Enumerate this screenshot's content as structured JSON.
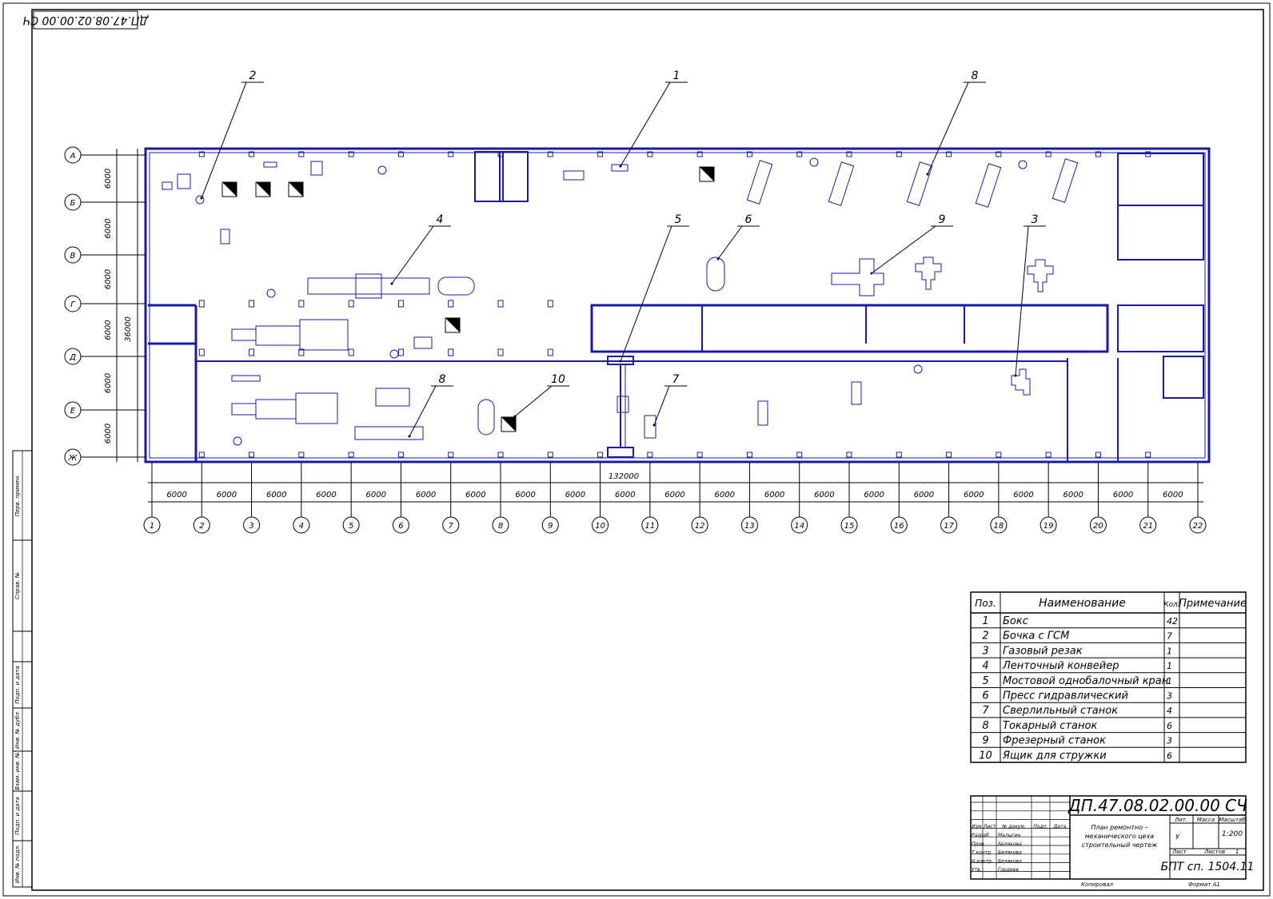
{
  "drawing": {
    "code_top": "ДП.47.08.02.00.00 СЧ",
    "code": "ДП.47.08.02.00.00 СЧ",
    "title_lines": [
      "План ремонтно –",
      "механического цеха",
      "строительный чертеж"
    ],
    "scale": "1:200",
    "lit": "У",
    "sheet_label": "Лист",
    "sheets_label": "Листов",
    "sheets_value": "1",
    "group": "БПТ сп. 1504.11",
    "copied": "Копировал",
    "format": "Формат А1",
    "col_headers": [
      "Лит.",
      "Масса",
      "Масштаб"
    ],
    "people_headers": [
      "Изм",
      "Лист",
      "№ докум.",
      "Подп.",
      "Дата"
    ],
    "people": [
      [
        "Разраб.",
        "Малыгин"
      ],
      [
        "Пров.",
        "Белякова"
      ],
      [
        "Т.контр.",
        "Белякова"
      ],
      [
        "Н.контр.",
        "Белякова"
      ],
      [
        "Утв.",
        "Гордеев"
      ]
    ],
    "side_stamp": [
      "Перв. примен.",
      "Справ. №",
      "Подп. и дата",
      "Инв. № дубл.",
      "Взам. инв. №",
      "Подп. и дата",
      "Инв. № подл."
    ]
  },
  "plan": {
    "row_axes": [
      "А",
      "Б",
      "В",
      "Г",
      "Д",
      "Е",
      "Ж"
    ],
    "row_spacing": [
      "6000",
      "6000",
      "6000",
      "6000",
      "6000",
      "6000"
    ],
    "total_width_dim": "36000",
    "col_axes": [
      "1",
      "2",
      "3",
      "4",
      "5",
      "6",
      "7",
      "8",
      "9",
      "10",
      "11",
      "12",
      "13",
      "14",
      "15",
      "16",
      "17",
      "18",
      "19",
      "20",
      "21",
      "22"
    ],
    "col_spacing": [
      "6000",
      "6000",
      "6000",
      "6000",
      "6000",
      "6000",
      "6000",
      "6000",
      "6000",
      "6000",
      "6000",
      "6000",
      "6000",
      "6000",
      "6000",
      "6000",
      "6000",
      "6000",
      "6000",
      "6000",
      "6000"
    ],
    "total_length_dim": "132000",
    "callouts": [
      "2",
      "1",
      "8",
      "4",
      "5",
      "6",
      "9",
      "3",
      "8",
      "10",
      "7"
    ]
  },
  "spec": {
    "headers": [
      "Поз.",
      "Наименование",
      "Кол.",
      "Примечание"
    ],
    "rows": [
      [
        "1",
        "Бокс",
        "42"
      ],
      [
        "2",
        "Бочка с ГСМ",
        "7"
      ],
      [
        "3",
        "Газовый резак",
        "1"
      ],
      [
        "4",
        "Ленточный конвейер",
        "1"
      ],
      [
        "5",
        "Мостовой однобалочный кран",
        "1"
      ],
      [
        "6",
        "Пресс гидравлический",
        "3"
      ],
      [
        "7",
        "Сверлильный станок",
        "4"
      ],
      [
        "8",
        "Токарный станок",
        "6"
      ],
      [
        "9",
        "Фрезерный станок",
        "3"
      ],
      [
        "10",
        "Ящик для стружки",
        "6"
      ]
    ]
  }
}
